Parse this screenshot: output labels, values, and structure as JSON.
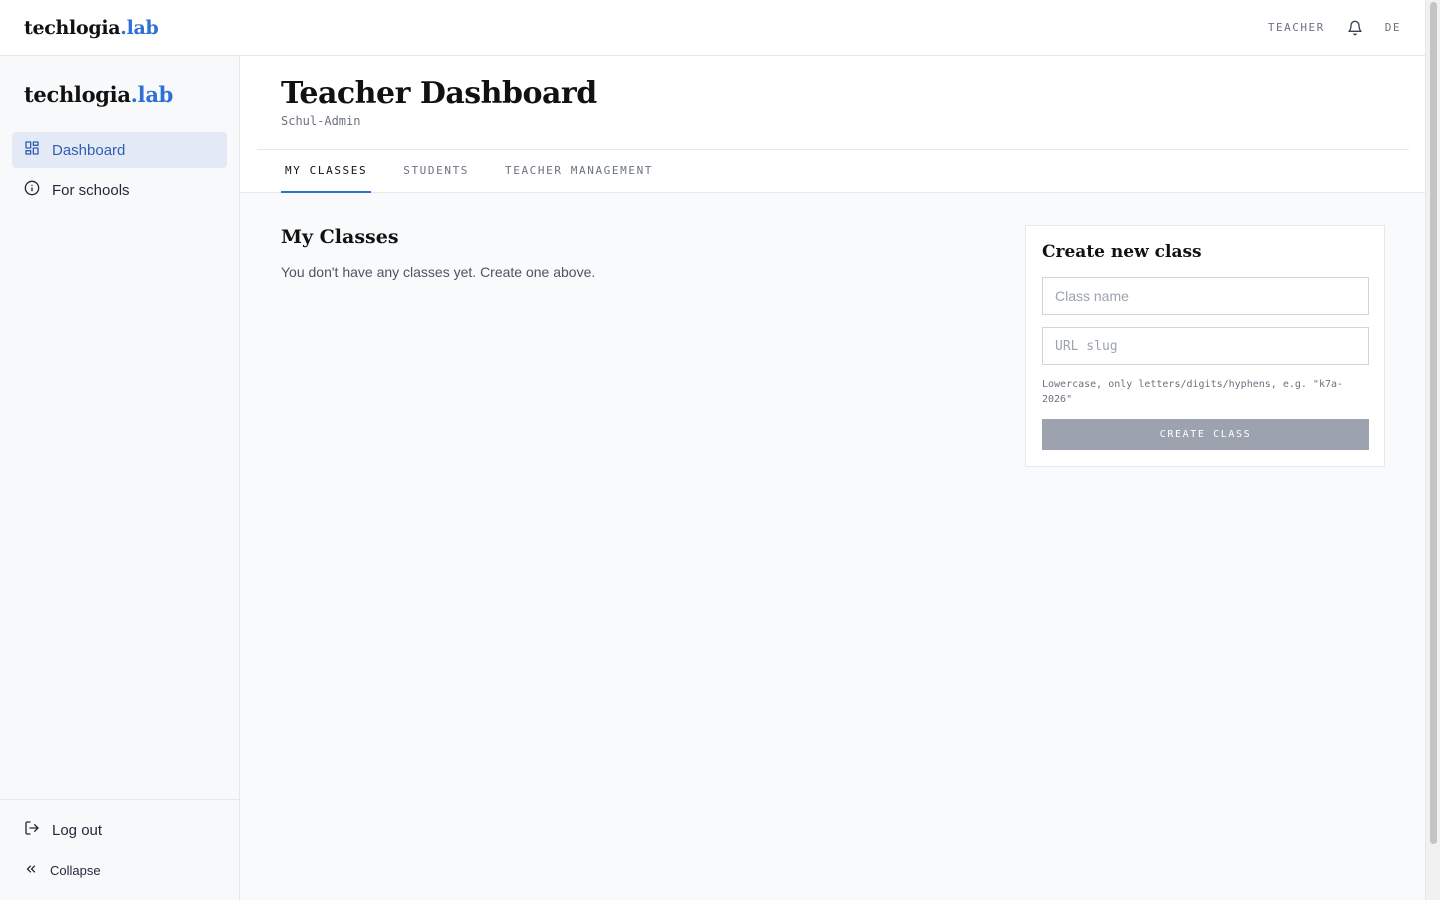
{
  "topbar": {
    "logo_main": "techlogia",
    "logo_accent": ".lab",
    "role": "TEACHER",
    "language": "DE"
  },
  "sidebar": {
    "logo_main": "techlogia",
    "logo_accent": ".lab",
    "items": [
      {
        "label": "Dashboard",
        "icon": "dashboard-icon",
        "active": true
      },
      {
        "label": "For schools",
        "icon": "info-icon",
        "active": false
      }
    ],
    "logout_label": "Log out",
    "collapse_label": "Collapse"
  },
  "header": {
    "title": "Teacher Dashboard",
    "subtitle": "Schul-Admin",
    "tabs": [
      {
        "label": "MY CLASSES",
        "active": true
      },
      {
        "label": "STUDENTS",
        "active": false
      },
      {
        "label": "TEACHER MANAGEMENT",
        "active": false
      }
    ]
  },
  "classes": {
    "title": "My Classes",
    "empty_message": "You don't have any classes yet. Create one above."
  },
  "create_form": {
    "title": "Create new class",
    "class_name_placeholder": "Class name",
    "class_name_value": "",
    "slug_placeholder": "URL slug",
    "slug_value": "",
    "hint": "Lowercase, only letters/digits/hyphens, e.g. \"k7a-2026\"",
    "submit_label": "CREATE CLASS"
  },
  "colors": {
    "accent": "#2f6fd6",
    "active_nav_bg": "#e3eaf6",
    "disabled_button": "#9ca3af"
  }
}
